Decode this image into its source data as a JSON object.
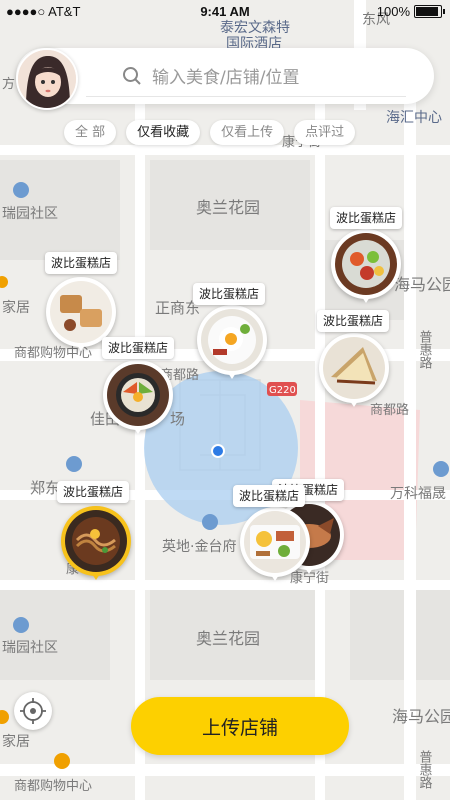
{
  "status_bar": {
    "carrier": "●●●●○ AT&T",
    "time": "9:41 AM",
    "battery": "100%"
  },
  "search": {
    "placeholder": "输入美食/店铺/位置"
  },
  "filters": [
    {
      "label": "全 部",
      "active": false
    },
    {
      "label": "仅看收藏",
      "active": true
    },
    {
      "label": "仅看上传",
      "active": false
    },
    {
      "label": "点评过",
      "active": false
    }
  ],
  "map_labels": {
    "hotel_1": "泰宏文森特",
    "hotel_2": "国际酒店",
    "road_dongfeng": "东风",
    "haihui": "海汇中心",
    "kangning_top": "康宁街",
    "aolan_top": "奥兰花园",
    "ruiyuan_top": "瑞园社区",
    "haima_top": "海马公园",
    "jiaju_top": "家居",
    "zhengshang": "正商东",
    "shangdu_mall": "商都购物中心",
    "shangdu_rd": "商都路",
    "puhui_top": "普惠路",
    "g220": "G220",
    "shangdu_rd_right": "商都路",
    "jiatian": "佳田",
    "chang": "场",
    "zhengdong": "郑东",
    "wanke": "万科福晟",
    "yingdi": "英地·金台府",
    "kangning_bottom": "康宁街",
    "kang_left": "康",
    "aolan_bottom": "奥兰花园",
    "ruiyuan_bottom": "瑞园社区",
    "haima_bottom": "海马公园",
    "jiaju_bottom": "家居",
    "shangdu_mall_bottom": "商都购物中心",
    "puhui_bottom": "普惠路",
    "fang": "方"
  },
  "pins": [
    {
      "label": "波比蛋糕店",
      "food": "salad"
    },
    {
      "label": "波比蛋糕店",
      "food": "toast"
    },
    {
      "label": "波比蛋糕店",
      "food": "eggs"
    },
    {
      "label": "波比蛋糕店",
      "food": "sandwich"
    },
    {
      "label": "波比蛋糕店",
      "food": "bibimbap"
    },
    {
      "label": "波比蛋糕店",
      "food": "noodles",
      "selected": true
    },
    {
      "label": "波比蛋糕店",
      "food": "breakfast"
    },
    {
      "label": "波比蛋糕店",
      "food": "fish"
    }
  ],
  "upload_button": {
    "label": "上传店铺"
  },
  "colors": {
    "accent": "#fdd000",
    "water_circle": "#a9cdf0",
    "user_dot": "#2d7be5",
    "road_highlight": "#f3b8b8"
  }
}
